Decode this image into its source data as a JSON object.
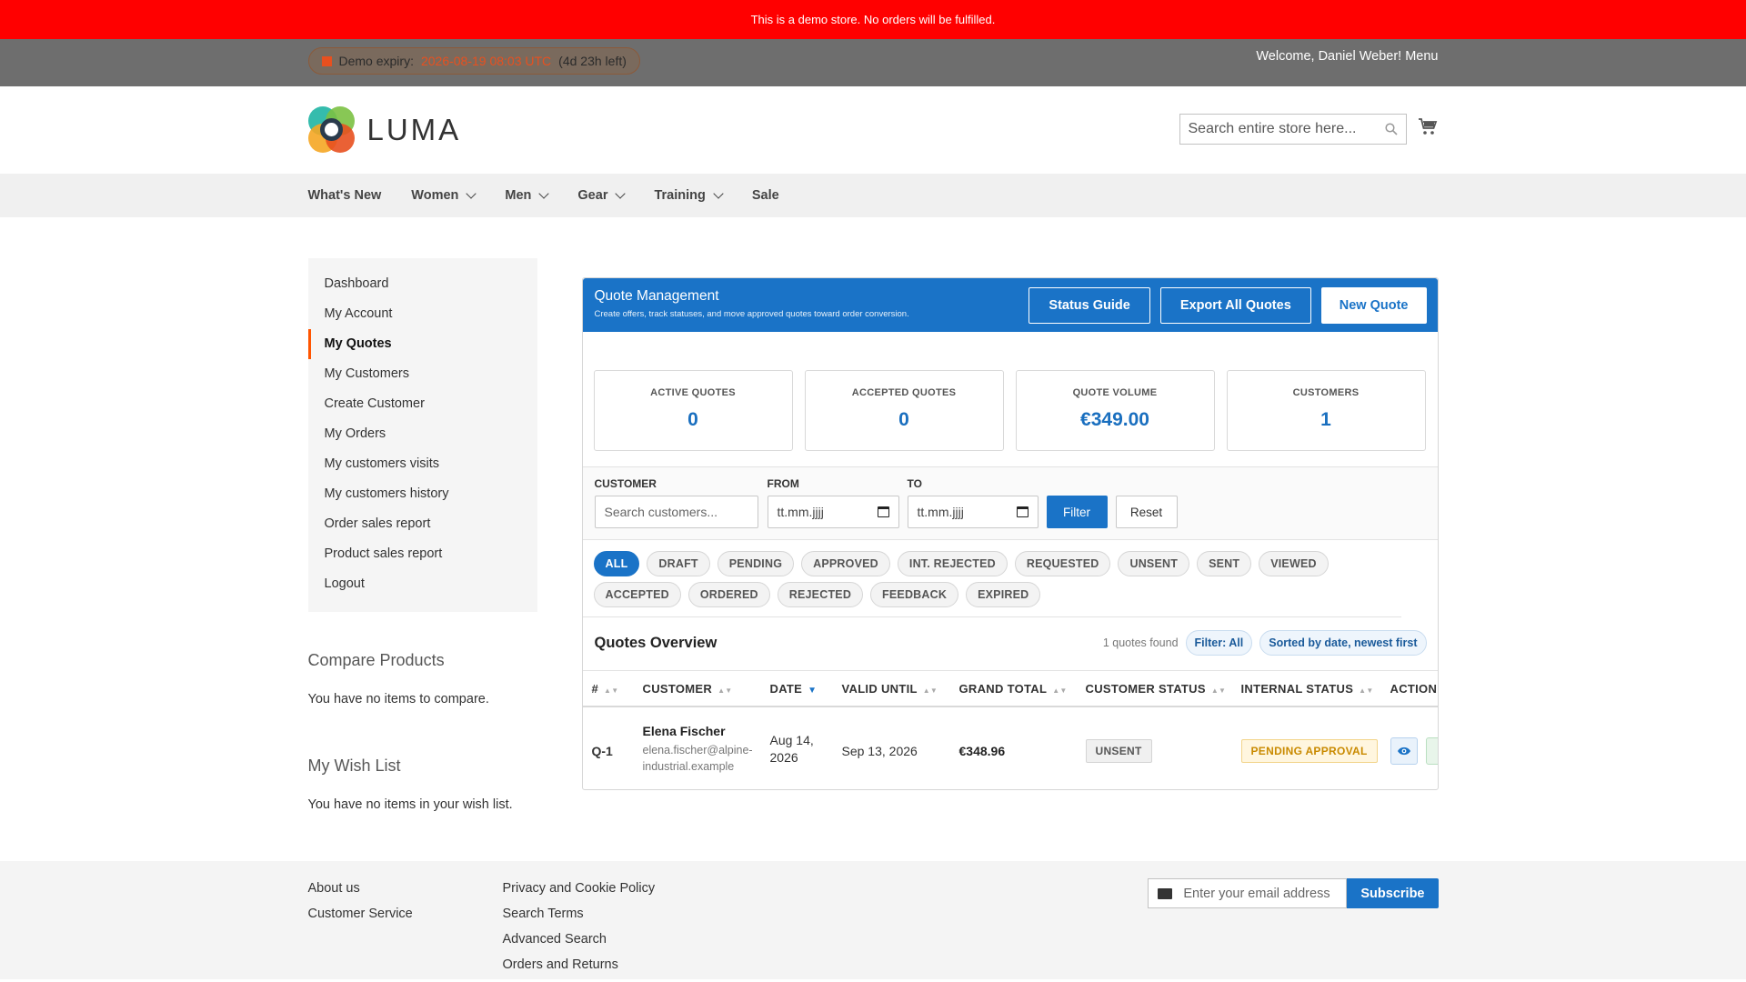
{
  "demo_notice": "This is a demo store. No orders will be fulfilled.",
  "panel": {
    "expiry_prefix": "Demo expiry:",
    "expiry_date": "2026-08-19 08:03 UTC",
    "expiry_left": "(4d 23h left)",
    "welcome": "Welcome, Daniel Weber! Menu"
  },
  "header": {
    "logo_text": "LUMA",
    "search_placeholder": "Search entire store here..."
  },
  "nav": [
    "What's New",
    "Women",
    "Men",
    "Gear",
    "Training",
    "Sale"
  ],
  "sidebar": {
    "items": [
      "Dashboard",
      "My Account",
      "My Quotes",
      "My Customers",
      "Create Customer",
      "My Orders",
      "My customers visits",
      "My customers history",
      "Order sales report",
      "Product sales report",
      "Logout"
    ],
    "active": "My Quotes"
  },
  "compare": {
    "title": "Compare Products",
    "text": "You have no items to compare."
  },
  "wishlist": {
    "title": "My Wish List",
    "text": "You have no items in your wish list."
  },
  "quote_mgmt": {
    "title": "Quote Management",
    "subtitle": "Create offers, track statuses, and move approved quotes toward order conversion.",
    "buttons": {
      "status_guide": "Status Guide",
      "export": "Export All Quotes",
      "new_quote": "New Quote"
    },
    "stats": [
      {
        "label": "ACTIVE QUOTES",
        "value": "0"
      },
      {
        "label": "ACCEPTED QUOTES",
        "value": "0"
      },
      {
        "label": "QUOTE VOLUME",
        "value": "€349.00"
      },
      {
        "label": "CUSTOMERS",
        "value": "1"
      }
    ],
    "filters": {
      "customer_label": "CUSTOMER",
      "customer_placeholder": "Search customers...",
      "from_label": "FROM",
      "from_value": "tt.mm.jjjj",
      "to_label": "TO",
      "to_value": "tt.mm.jjjj",
      "filter_button": "Filter",
      "reset_button": "Reset"
    },
    "chips": [
      "ALL",
      "DRAFT",
      "PENDING",
      "APPROVED",
      "INT. REJECTED",
      "REQUESTED",
      "UNSENT",
      "SENT",
      "VIEWED",
      "ACCEPTED",
      "ORDERED",
      "REJECTED",
      "FEEDBACK",
      "EXPIRED"
    ],
    "active_chip": "ALL",
    "overview": {
      "title": "Quotes Overview",
      "found": "1 quotes found",
      "filter_pill": "Filter: All",
      "sort_pill": "Sorted by date, newest first"
    },
    "table": {
      "columns": [
        "#",
        "CUSTOMER",
        "DATE",
        "VALID UNTIL",
        "GRAND TOTAL",
        "CUSTOMER STATUS",
        "INTERNAL STATUS",
        "ACTION"
      ],
      "rows": [
        {
          "id": "Q-1",
          "customer_name": "Elena Fischer",
          "customer_email_1": "elena.fischer@alpine-",
          "customer_email_2": "industrial.example",
          "date_1": "Aug 14,",
          "date_2": "2026",
          "valid_until": "Sep 13, 2026",
          "grand_total": "€348.96",
          "customer_status": "UNSENT",
          "internal_status": "PENDING APPROVAL"
        }
      ]
    }
  },
  "footer": {
    "col1": [
      "About us",
      "Customer Service"
    ],
    "col2": [
      "Privacy and Cookie Policy",
      "Search Terms",
      "Advanced Search",
      "Orders and Returns"
    ],
    "newsletter_placeholder": "Enter your email address",
    "subscribe": "Subscribe"
  },
  "colors": {
    "accent": "#1a73c7",
    "demo_bar": "#ff0000",
    "active_marker": "#ff5501"
  },
  "icons": {
    "search": "search-icon",
    "cart": "cart-icon",
    "view": "eye-icon",
    "mail": "mail-icon",
    "calendar": "calendar-icon"
  }
}
